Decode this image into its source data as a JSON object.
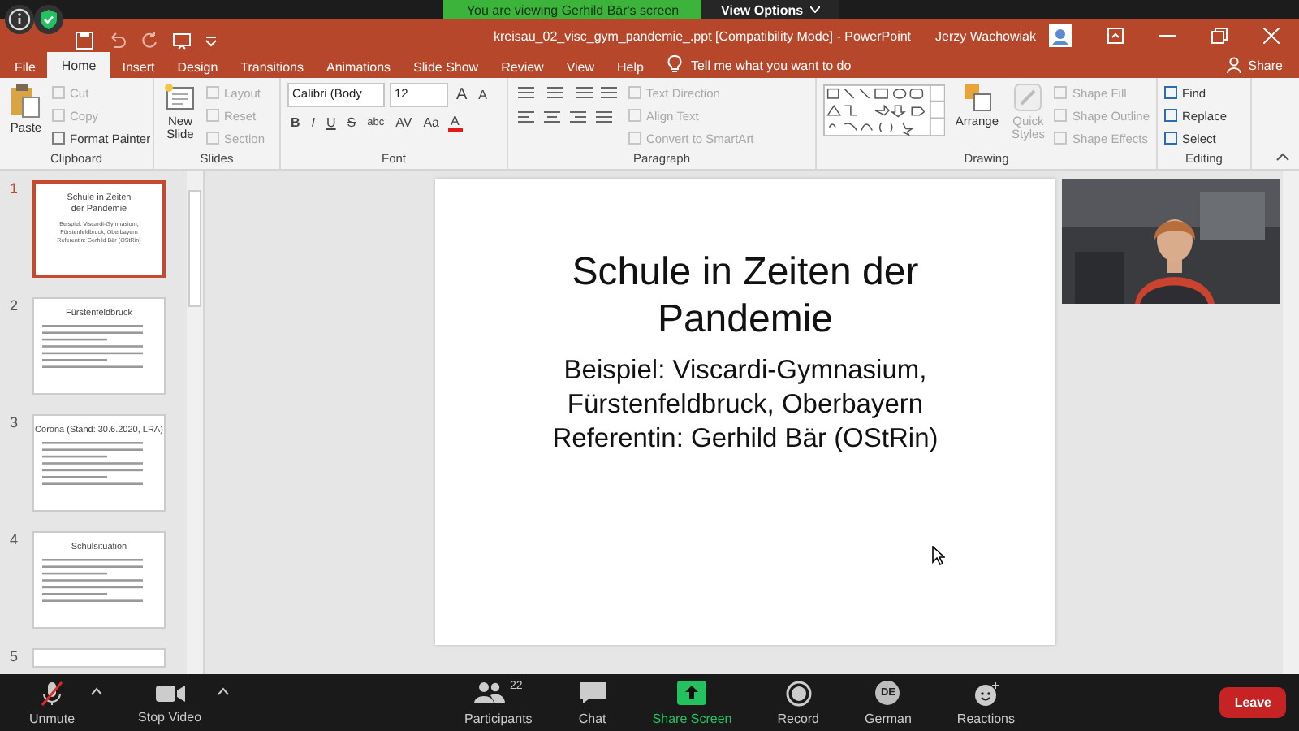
{
  "share_banner": {
    "text": "You are viewing Gerhild Bär's screen",
    "options": "View Options"
  },
  "title_bar": {
    "title": "kreisau_02_visc_gym_pandemie_.ppt [Compatibility Mode]  -  PowerPoint",
    "user": "Jerzy Wachowiak"
  },
  "tabs": [
    {
      "label": "File",
      "selected": false
    },
    {
      "label": "Home",
      "selected": true
    },
    {
      "label": "Insert",
      "selected": false
    },
    {
      "label": "Design",
      "selected": false
    },
    {
      "label": "Transitions",
      "selected": false
    },
    {
      "label": "Animations",
      "selected": false
    },
    {
      "label": "Slide Show",
      "selected": false
    },
    {
      "label": "Review",
      "selected": false
    },
    {
      "label": "View",
      "selected": false
    },
    {
      "label": "Help",
      "selected": false
    }
  ],
  "tell_me": "Tell me what you want to do",
  "share": "Share",
  "ribbon": {
    "clipboard": {
      "label": "Clipboard",
      "paste": "Paste",
      "items": [
        {
          "label": "Cut",
          "disabled": true
        },
        {
          "label": "Copy",
          "disabled": true
        },
        {
          "label": "Format Painter",
          "disabled": false
        }
      ]
    },
    "slides": {
      "label": "Slides",
      "new_slide": [
        "New",
        "Slide"
      ],
      "items": [
        {
          "label": "Layout",
          "disabled": true
        },
        {
          "label": "Reset",
          "disabled": true
        },
        {
          "label": "Section",
          "disabled": true
        }
      ]
    },
    "font": {
      "label": "Font",
      "font_name": "Calibri (Body",
      "font_size": "12",
      "size_buttons": [
        "A",
        "A"
      ],
      "buttons": [
        "B",
        "I",
        "U",
        "S",
        "abc",
        "AV",
        "Aa",
        "A"
      ]
    },
    "paragraph": {
      "label": "Paragraph",
      "items": [
        {
          "label": "Text Direction",
          "disabled": true
        },
        {
          "label": "Align Text",
          "disabled": true
        },
        {
          "label": "Convert to SmartArt",
          "disabled": true
        }
      ]
    },
    "drawing": {
      "label": "Drawing",
      "arrange": "Arrange",
      "quick_styles": {
        "label": [
          "Quick",
          "Styles"
        ],
        "disabled": true
      },
      "items": [
        {
          "label": "Shape Fill",
          "disabled": true
        },
        {
          "label": "Shape Outline",
          "disabled": true
        },
        {
          "label": "Shape Effects",
          "disabled": true
        }
      ]
    },
    "editing": {
      "label": "Editing",
      "items": [
        {
          "label": "Find",
          "disabled": false
        },
        {
          "label": "Replace",
          "disabled": false
        },
        {
          "label": "Select",
          "disabled": false
        }
      ]
    }
  },
  "slides": [
    {
      "number": "1",
      "selected": true,
      "kind": "title",
      "title": "Schule in Zeiten der Pandemie",
      "lines": [
        "Beispiel: Viscardi-Gymnasium,",
        "Fürstenfeldbruck, Oberbayern",
        "Referentin: Gerhild Bär (OStRin)"
      ]
    },
    {
      "number": "2",
      "selected": false,
      "kind": "bullets",
      "title": "Fürstenfeldbruck"
    },
    {
      "number": "3",
      "selected": false,
      "kind": "bullets",
      "title": "Corona (Stand: 30.6.2020, LRA)"
    },
    {
      "number": "4",
      "selected": false,
      "kind": "bullets",
      "title": "Schulsituation"
    },
    {
      "number": "5",
      "selected": false,
      "kind": "partial"
    }
  ],
  "current_slide": {
    "title": [
      "Schule in Zeiten der",
      "Pandemie"
    ],
    "lines": [
      "Beispiel: Viscardi-Gymnasium,",
      "Fürstenfeldbruck, Oberbayern",
      "Referentin: Gerhild Bär (OStRin)"
    ]
  },
  "meeting_bar": {
    "left": [
      {
        "label": "Unmute",
        "kind": "mic"
      },
      {
        "label": "Stop Video",
        "kind": "video"
      }
    ],
    "center": [
      {
        "label": "Participants",
        "kind": "participants",
        "count": "22"
      },
      {
        "label": "Chat",
        "kind": "chat"
      },
      {
        "label": "Share Screen",
        "kind": "share"
      },
      {
        "label": "Record",
        "kind": "record"
      },
      {
        "label": "German",
        "kind": "language",
        "badge": "DE"
      },
      {
        "label": "Reactions",
        "kind": "reactions"
      }
    ],
    "leave": "Leave"
  }
}
